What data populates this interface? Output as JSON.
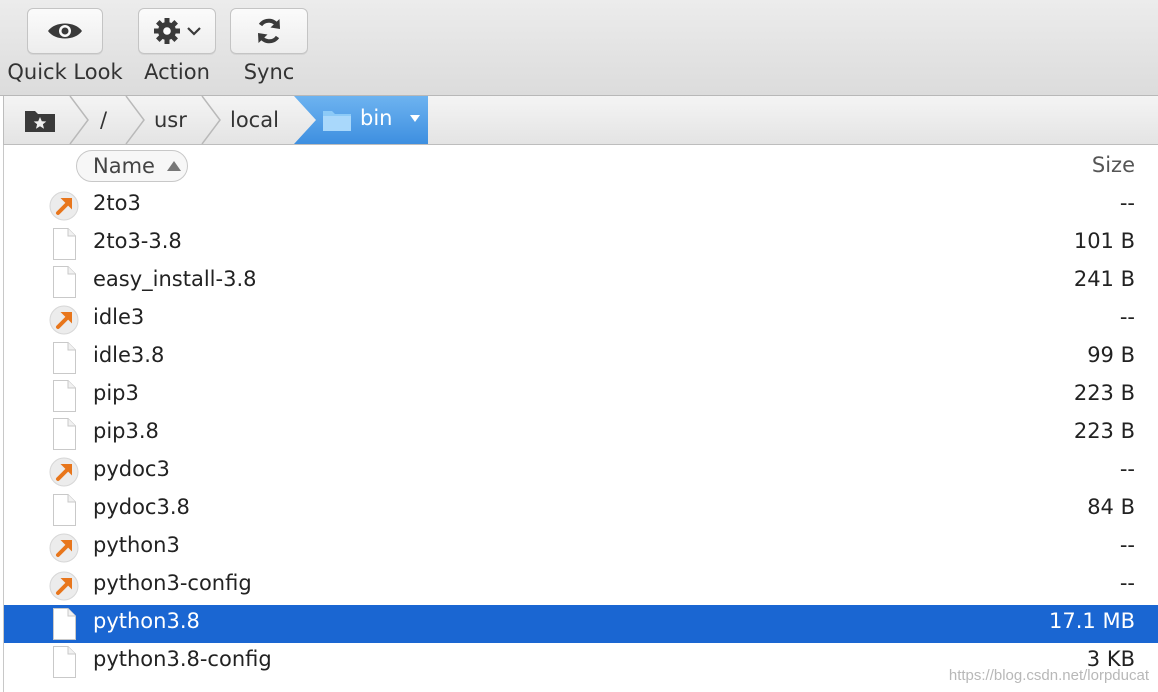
{
  "toolbar": {
    "quick_look": {
      "label": "Quick Look",
      "icon": "eye-icon"
    },
    "action": {
      "label": "Action",
      "icon": "gear-icon"
    },
    "sync": {
      "label": "Sync",
      "icon": "refresh-icon"
    }
  },
  "path": {
    "home_icon": "favorites-folder-icon",
    "crumbs": [
      "/",
      "usr",
      "local"
    ],
    "current": "bin",
    "accent": "#4a98e6"
  },
  "columns": {
    "name": "Name",
    "size": "Size"
  },
  "files": [
    {
      "name": "2to3",
      "size": "--",
      "kind": "alias"
    },
    {
      "name": "2to3-3.8",
      "size": "101 B",
      "kind": "file"
    },
    {
      "name": "easy_install-3.8",
      "size": "241 B",
      "kind": "file"
    },
    {
      "name": "idle3",
      "size": "--",
      "kind": "alias"
    },
    {
      "name": "idle3.8",
      "size": "99 B",
      "kind": "file"
    },
    {
      "name": "pip3",
      "size": "223 B",
      "kind": "file"
    },
    {
      "name": "pip3.8",
      "size": "223 B",
      "kind": "file"
    },
    {
      "name": "pydoc3",
      "size": "--",
      "kind": "alias"
    },
    {
      "name": "pydoc3.8",
      "size": "84 B",
      "kind": "file"
    },
    {
      "name": "python3",
      "size": "--",
      "kind": "alias"
    },
    {
      "name": "python3-config",
      "size": "--",
      "kind": "alias"
    },
    {
      "name": "python3.8",
      "size": "17.1 MB",
      "kind": "file",
      "selected": true
    },
    {
      "name": "python3.8-config",
      "size": "3 KB",
      "kind": "file"
    }
  ],
  "selection_color": "#1a66d2",
  "watermark": "https://blog.csdn.net/lorpducat"
}
